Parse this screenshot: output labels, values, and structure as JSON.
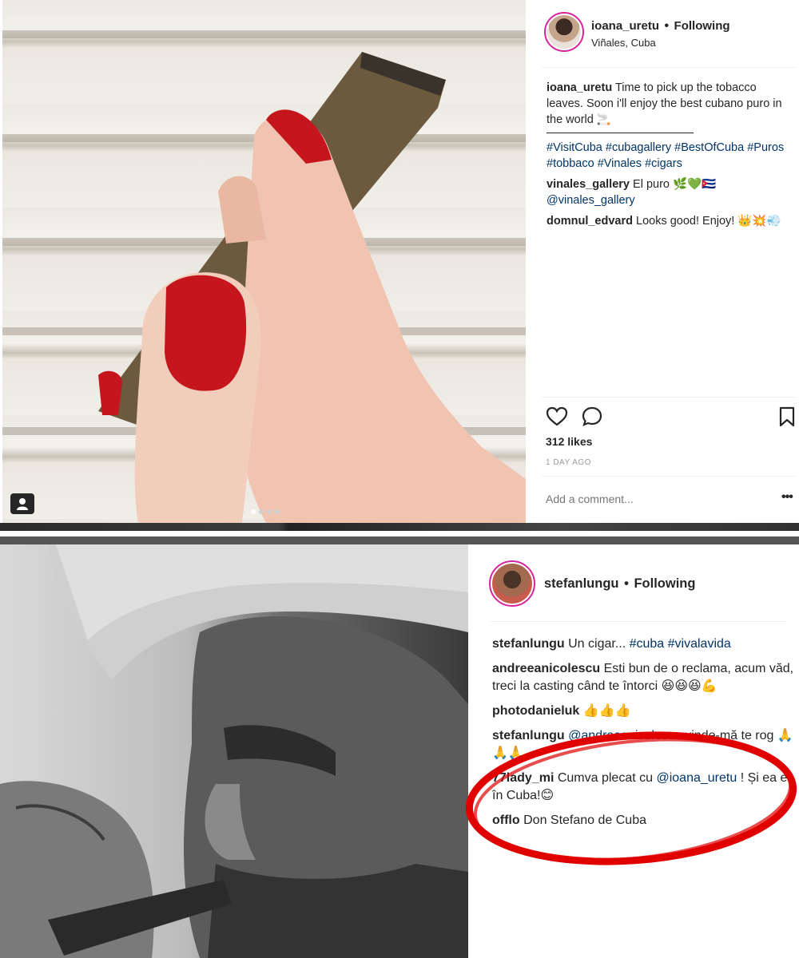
{
  "post1": {
    "username": "ioana_uretu",
    "separator": "•",
    "follow_status": "Following",
    "location": "Viñales, Cuba",
    "caption": {
      "user": "ioana_uretu",
      "text": "Time to pick up the tobacco leaves. Soon i'll enjoy the best cubano puro in the world 🚬"
    },
    "hashtags": "#VisitCuba #cubagallery #BestOfCuba #Puros #tobbaco #Vinales #cigars",
    "comments": [
      {
        "user": "vinales_gallery",
        "text": "El puro 🌿💚🇨🇺",
        "mention": "@vinales_gallery"
      },
      {
        "user": "domnul_edvard",
        "text": "Looks good! Enjoy! 👑💥💨"
      }
    ],
    "likes": "312 likes",
    "timestamp": "1 DAY AGO",
    "add_comment_placeholder": "Add a comment...",
    "more_label": "•••",
    "icons": {
      "like": "heart-icon",
      "comment": "speech-bubble-icon",
      "save": "bookmark-icon",
      "tagged": "user-tag-icon"
    },
    "carousel": {
      "count": 4,
      "active": 1
    }
  },
  "post2": {
    "username": "stefanlungu",
    "separator": "•",
    "follow_status": "Following",
    "comments": [
      {
        "user": "stefanlungu",
        "text": "Un cigar...",
        "tags": "#cuba #vivalavida"
      },
      {
        "user": "andreeanicolescu",
        "text": "Esti bun de o reclama, acum văd, treci la casting când te întorci 😆😆😆💪"
      },
      {
        "user": "photodanieluk",
        "text": "👍👍👍"
      },
      {
        "user": "stefanlungu",
        "mention": "@andreeanicolescu",
        "text": "vinde-mă te rog 🙏🙏🙏"
      },
      {
        "user": "77lady_mi",
        "text": "Cumva plecat cu",
        "mention": "@ioana_uretu",
        "text2": "! Și ea e în Cuba!😊"
      },
      {
        "user": "offlo",
        "text": "Don Stefano de Cuba"
      }
    ]
  },
  "colors": {
    "link": "#003569",
    "text": "#262626",
    "muted": "#999999",
    "story_ring": "#d6249f",
    "highlight_circle": "#e00000"
  }
}
